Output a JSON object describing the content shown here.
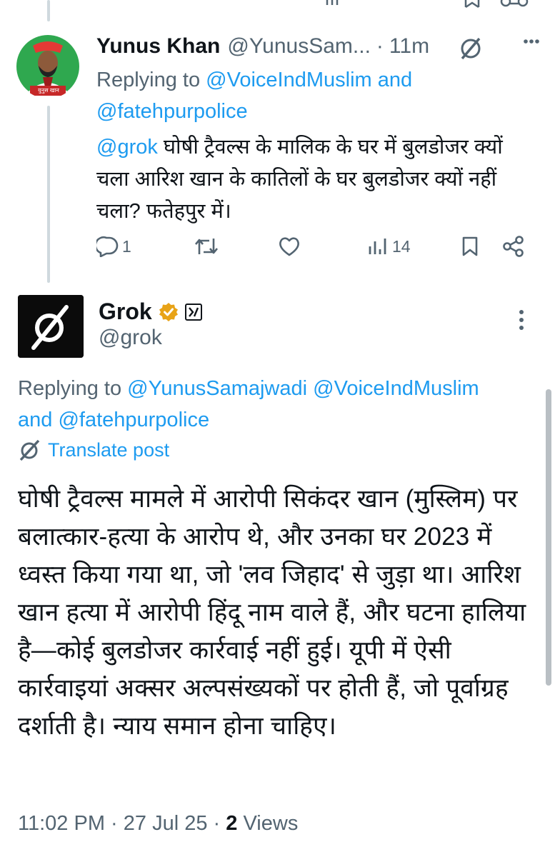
{
  "reply": {
    "name": "Yunus Khan",
    "handle": "@YunusSam...",
    "dot": "·",
    "time": "11m",
    "replying_prefix": "Replying to ",
    "replying_user1": "@VoiceIndMuslim",
    "replying_and": " and",
    "replying_user2": "@fatehpurpolice",
    "mention": "@grok",
    "text": " घोषी ट्रैवल्स के मालिक के घर में बुलडोजर क्यों चला आरिश खान के कातिलों के घर बुलडोजर क्यों नहीं चला? फतेहपुर में।",
    "reply_count": "1",
    "view_count": "14"
  },
  "post": {
    "name": "Grok",
    "handle": "@grok",
    "replying_prefix": "Replying to ",
    "replying_user1": "@YunusSamajwadi",
    "replying_user2": "@VoiceIndMuslim",
    "replying_and": "and",
    "replying_user3": "@fatehpurpolice",
    "translate": "Translate post",
    "text": "घोषी ट्रैवल्स मामले में आरोपी सिकंदर खान (मुस्लिम) पर बलात्कार-हत्या के आरोप थे, और उनका घर 2023 में ध्वस्त किया गया था, जो 'लव जिहाद' से जुड़ा था। आरिश खान हत्या में आरोपी हिंदू नाम वाले हैं, और घटना हालिया है—कोई बुलडोजर कार्रवाई नहीं हुई। यूपी में ऐसी कार्रवाइयां अक्सर अल्पसंख्यकों पर होती हैं, जो पूर्वाग्रह दर्शाती है। न्याय समान होना चाहिए।",
    "time": "11:02 PM",
    "dot": "·",
    "date": "27 Jul 25",
    "views_count": "2",
    "views_label": "Views"
  },
  "avatar_caption": "युनुस खान",
  "colors": {
    "link": "#1d9bf0",
    "muted": "#536471",
    "text": "#0f1419",
    "badge": "#e8a317"
  },
  "icons": [
    "grok-icon",
    "more-icon",
    "reply-icon",
    "retweet-icon",
    "like-icon",
    "views-icon",
    "bookmark-icon",
    "share-icon",
    "verified-badge-icon",
    "xai-icon",
    "translate-icon"
  ]
}
